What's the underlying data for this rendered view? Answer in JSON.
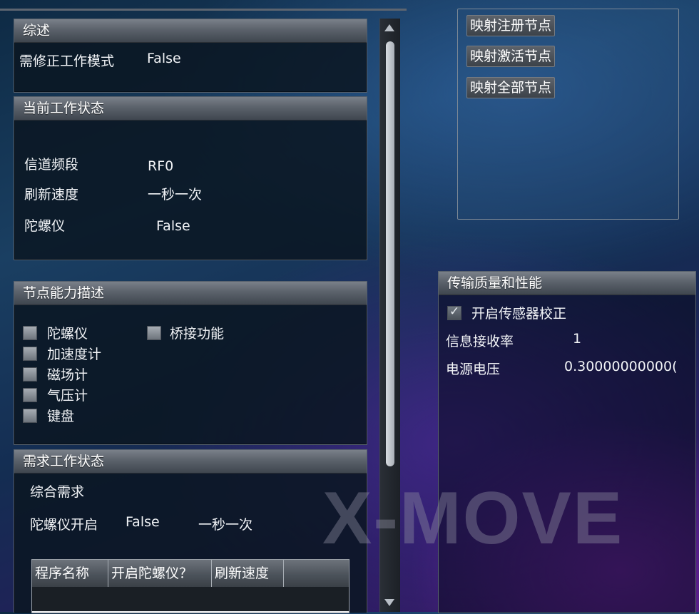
{
  "summary": {
    "title": "综述",
    "mode_label": "需修正工作模式",
    "mode_value": "False"
  },
  "current_state": {
    "title": "当前工作状态",
    "channel_label": "信道频段",
    "channel_value": "RF0",
    "refresh_label": "刷新速度",
    "refresh_value": "一秒一次",
    "gyro_label": "陀螺仪",
    "gyro_value": "False"
  },
  "capabilities": {
    "title": "节点能力描述",
    "items": [
      {
        "label": "陀螺仪",
        "checked": false
      },
      {
        "label": "加速度计",
        "checked": false
      },
      {
        "label": "磁场计",
        "checked": false
      },
      {
        "label": "气压计",
        "checked": false
      },
      {
        "label": "键盘",
        "checked": false
      },
      {
        "label": "桥接功能",
        "checked": false
      }
    ]
  },
  "demand": {
    "title": "需求工作状态",
    "overall_label": "综合需求",
    "gyro_on_label": "陀螺仪开启",
    "gyro_on_value": "False",
    "refresh_value": "一秒一次",
    "grid_columns": [
      "程序名称",
      "开启陀螺仪？",
      "刷新速度",
      ""
    ]
  },
  "map_actions": {
    "buttons": [
      "映射注册节点",
      "映射激活节点",
      "映射全部节点"
    ]
  },
  "transmission": {
    "title": "传输质量和性能",
    "calibrate_label": "开启传感器校正",
    "calibrate_checked": true,
    "recv_rate_label": "信息接收率",
    "recv_rate_value": "1",
    "voltage_label": "电源电压",
    "voltage_value": "0.30000000000("
  },
  "watermark": "X-MOVE"
}
